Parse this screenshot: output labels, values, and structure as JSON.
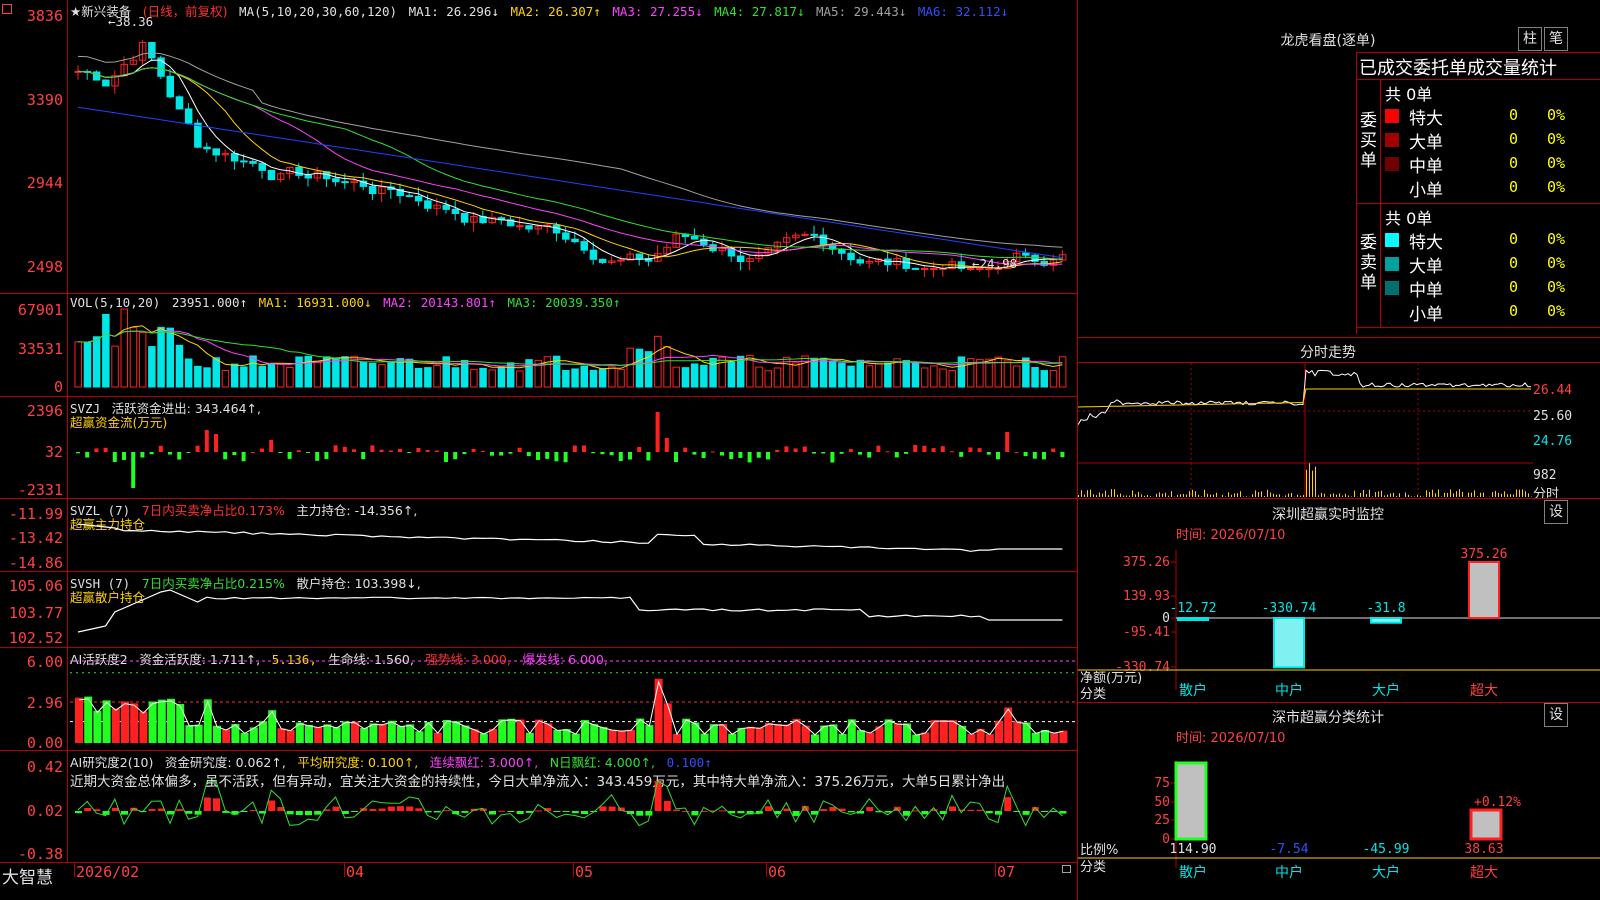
{
  "main": {
    "logo_icon": "square-window-icon",
    "stock_name": "★新兴装备",
    "mode": "(日线，前复权)",
    "ma_title": "MA(5,10,20,30,60,120)",
    "ma1": "MA1: 26.296↓",
    "ma2": "MA2: 26.307↑",
    "ma3": "MA3: 27.255↓",
    "ma4": "MA4: 27.817↓",
    "ma5": "MA5: 29.443↓",
    "ma6": "MA6: 32.112↓",
    "high_label": "←38.36",
    "low_label": "←24.98",
    "yaxis": [
      "3836",
      "3390",
      "2944",
      "2498"
    ],
    "colors": {
      "up": "#ff2020",
      "down": "#00e5e5",
      "ma1": "#ffffff",
      "ma2": "#ffd200",
      "ma3": "#ff40ff",
      "ma4": "#30e030",
      "ma5": "#a0a0a0",
      "ma6": "#2040ff"
    }
  },
  "vol": {
    "title": "VOL(5,10,20)",
    "value": "23951.000↑",
    "ma1": "MA1: 16931.000↓",
    "ma2": "MA2: 20143.801↑",
    "ma3": "MA3: 20039.350↑",
    "yaxis": [
      "67901",
      "33531",
      "0"
    ]
  },
  "svzj": {
    "title": "SVZJ",
    "line1": "活跃资金进出: 343.464↑,",
    "line2": "超赢资金流(万元)",
    "yaxis": [
      "2396",
      "32",
      "-2331"
    ]
  },
  "svzl": {
    "title": "SVZL (7)",
    "ratio": "7日内买卖净占比0.173%",
    "hold": "主力持仓: -14.356↑,",
    "line2": "超赢主力持仓",
    "yaxis": [
      "-11.99",
      "-13.42",
      "-14.86"
    ]
  },
  "svsh": {
    "title": "SVSH (7)",
    "ratio": "7日内买卖净占比0.215%",
    "hold": "散户持仓: 103.398↓,",
    "line2": "超赢散户持仓",
    "yaxis": [
      "105.06",
      "103.77",
      "102.52"
    ]
  },
  "ai2": {
    "title": "AI活跃度2",
    "act": "资金活跃度: 1.711↑,",
    "v2": "5.136,",
    "life": "生命线: 1.560,",
    "strong": "强势线: 3.000,",
    "burst": "爆发线: 6.000,",
    "yaxis": [
      "6.00",
      "2.96",
      "0.00"
    ]
  },
  "air": {
    "title": "AI研究度2(10)",
    "res": "资金研究度: 0.062↑,",
    "avg": "平均研究度: 0.100↑,",
    "cont": "连续飘红: 3.000↑,",
    "nday": "N日飘红: 4.000↑,",
    "extra": "0.100↑",
    "text": "近期大资金总体偏多，虽不活跃，但有异动，宜关注大资金的持续性，今日大单净流入：343.459万元，其中特大单净流入：375.26万元，大单5日累计净出",
    "yaxis": [
      "0.42",
      "0.02",
      "-0.38"
    ]
  },
  "xaxis": {
    "app_name": "大智慧",
    "labels": [
      "2026/02",
      "04",
      "05",
      "06",
      "07"
    ]
  },
  "right": {
    "dragon_title": "龙虎看盘(逐单)",
    "btn_bar": "柱",
    "btn_pen": "笔",
    "stats_title": "已成交委托单成交量统计",
    "buy_total": "共 0单",
    "buy_side": "委买单",
    "sell_total": "共 0单",
    "sell_side": "委卖单",
    "buy_rows": [
      {
        "name": "特大",
        "count": "0",
        "pct": "0%",
        "color": "#ff0000"
      },
      {
        "name": "大单",
        "count": "0",
        "pct": "0%",
        "color": "#a00000"
      },
      {
        "name": "中单",
        "count": "0",
        "pct": "0%",
        "color": "#700000"
      },
      {
        "name": "小单",
        "count": "0",
        "pct": "0%",
        "color": ""
      }
    ],
    "sell_rows": [
      {
        "name": "特大",
        "count": "0",
        "pct": "0%",
        "color": "#00ffff"
      },
      {
        "name": "大单",
        "count": "0",
        "pct": "0%",
        "color": "#00a0a0"
      },
      {
        "name": "中单",
        "count": "0",
        "pct": "0%",
        "color": "#007070"
      },
      {
        "name": "小单",
        "count": "0",
        "pct": "0%",
        "color": ""
      }
    ],
    "intraday_title": "分时走势",
    "intraday_y": [
      "26.44",
      "25.60",
      "24.76"
    ],
    "intraday_vol": "982",
    "intraday_unit": "分时",
    "monitor_title": "深圳超赢实时监控",
    "btn_set": "设",
    "monitor_time": "时间: 2026/07/10",
    "monitor_y": [
      "375.26",
      "139.93",
      "0",
      "-95.41",
      "-330.74"
    ],
    "monitor_unit": "净额(万元)",
    "monitor_cat_label": "分类",
    "monitor_categories": [
      "散户",
      "中户",
      "大户",
      "超大"
    ],
    "monitor_values": [
      "-12.72",
      "-330.74",
      "-31.8",
      "375.26"
    ],
    "class_title": "深市超赢分类统计",
    "class_time": "时间: 2026/07/10",
    "class_y": [
      "75",
      "50",
      "25",
      "0"
    ],
    "class_unit": "比例%",
    "class_cat_label": "分类",
    "class_values": [
      "114.90",
      "-7.54",
      "-45.99",
      "38.63"
    ],
    "class_note": "+0.12%"
  }
}
